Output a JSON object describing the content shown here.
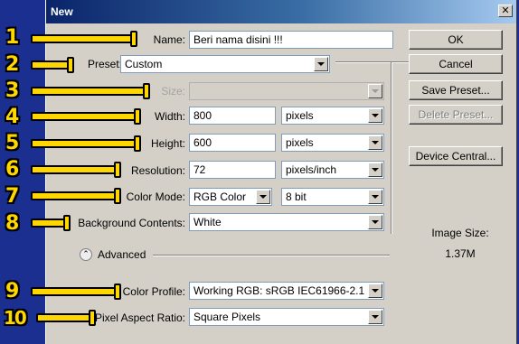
{
  "window": {
    "title": "New"
  },
  "fields": {
    "name": {
      "label": "Name:",
      "value": "Beri nama disini !!!"
    },
    "preset": {
      "label": "Preset:",
      "value": "Custom"
    },
    "size": {
      "label": "Size:",
      "value": ""
    },
    "width": {
      "label": "Width:",
      "value": "800",
      "unit": "pixels"
    },
    "height": {
      "label": "Height:",
      "value": "600",
      "unit": "pixels"
    },
    "resolution": {
      "label": "Resolution:",
      "value": "72",
      "unit": "pixels/inch"
    },
    "color_mode": {
      "label": "Color Mode:",
      "value": "RGB Color",
      "depth": "8 bit"
    },
    "background": {
      "label": "Background Contents:",
      "value": "White"
    },
    "advanced": {
      "label": "Advanced"
    },
    "color_profile": {
      "label": "Color Profile:",
      "value": "Working RGB:  sRGB IEC61966-2.1"
    },
    "pixel_aspect": {
      "label": "Pixel Aspect Ratio:",
      "value": "Square Pixels"
    }
  },
  "buttons": {
    "ok": "OK",
    "cancel": "Cancel",
    "save_preset": "Save Preset...",
    "delete_preset": "Delete Preset...",
    "device_central": "Device Central..."
  },
  "image_size": {
    "label": "Image Size:",
    "value": "1.37M"
  },
  "annotations": [
    "1",
    "2",
    "3",
    "4",
    "5",
    "6",
    "7",
    "8",
    "9",
    "10"
  ],
  "colors": {
    "background": "#1a2f8f",
    "annotation": "#ffd700",
    "titlebar": "#0a246a"
  }
}
